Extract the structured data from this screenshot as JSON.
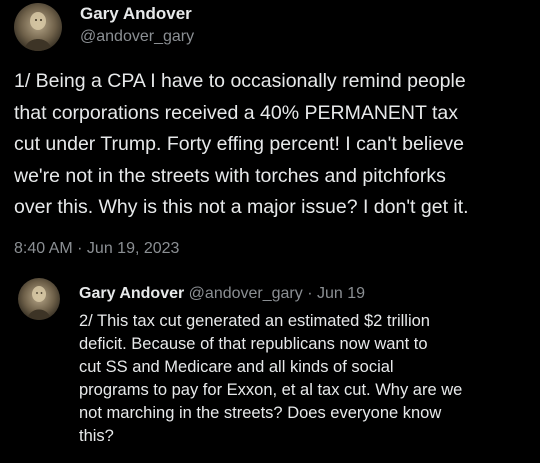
{
  "main_tweet": {
    "author_name": "Gary Andover",
    "handle": "@andover_gary",
    "avatar_icon": "profile-photo-icon",
    "lines": [
      "1/ Being a CPA I have to occasionally remind people",
      "that corporations received a 40% PERMANENT tax",
      "cut under Trump. Forty effing percent! I can't believe",
      "we're not in the streets with torches and pitchforks",
      "over this. Why is this not a major issue? I don't get it."
    ],
    "timestamp": "8:40 AM · Jun 19, 2023"
  },
  "reply_tweet": {
    "author_name": "Gary Andover",
    "handle": "@andover_gary",
    "separator": "·",
    "date": "Jun 19",
    "avatar_icon": "profile-photo-icon",
    "lines": [
      "2/ This tax cut generated an estimated $2 trillion",
      "deficit. Because of that republicans now want to",
      "cut SS and Medicare and all kinds of social",
      "programs to pay for Exxon, et al tax cut. Why are we",
      "not marching in the streets? Does everyone know",
      "this?"
    ]
  },
  "colors": {
    "background": "#000000",
    "primary_text": "#e7e9ea",
    "secondary_text": "#8b8f93"
  }
}
